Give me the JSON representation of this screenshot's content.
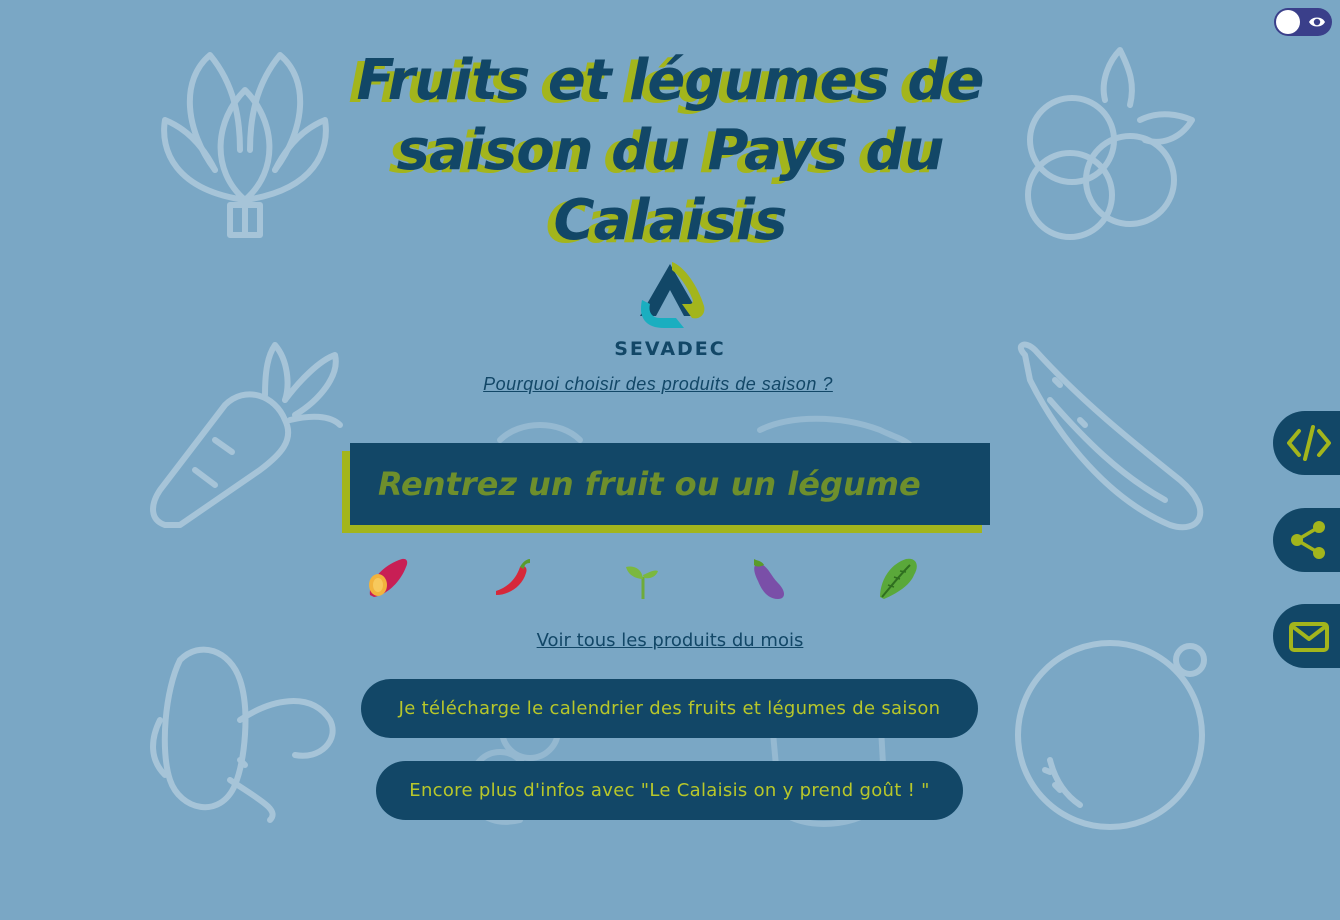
{
  "page": {
    "title": "Fruits et légumes de saison du Pays du Calaisis",
    "logo_text": "SEVADEC",
    "why_link": "Pourquoi choisir des produits de saison ?",
    "search_placeholder": "Rentrez un fruit ou un légume",
    "month_link": "Voir tous les produits du mois",
    "download_button": "Je télécharge le calendrier des fruits et légumes de saison",
    "more_info_button": "Encore plus d'infos avec \"Le Calaisis on y prend goût ! \""
  },
  "vegetables": [
    "sweet-potato",
    "chili-pepper",
    "sprout",
    "eggplant",
    "lettuce"
  ],
  "side_actions": [
    "embed-code",
    "share",
    "email"
  ],
  "colors": {
    "background": "#7aa7c5",
    "navy": "#124767",
    "accent_yellow_green": "#a3b51c",
    "toggle_purple": "#3a3f8a"
  }
}
